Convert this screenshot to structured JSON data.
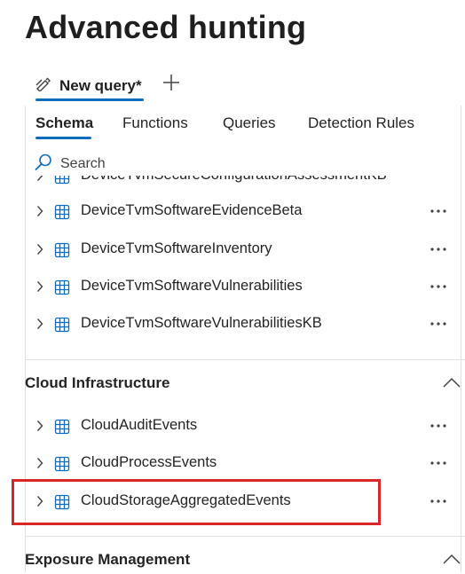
{
  "page": {
    "title": "Advanced hunting"
  },
  "query_tab": {
    "label": "New query*",
    "icon": "edit-pencil-icon",
    "add_icon": "plus-icon"
  },
  "subtabs": [
    {
      "label": "Schema",
      "active": true
    },
    {
      "label": "Functions",
      "active": false
    },
    {
      "label": "Queries",
      "active": false
    },
    {
      "label": "Detection Rules",
      "active": false
    }
  ],
  "search": {
    "label": "Search",
    "icon": "search-icon"
  },
  "device_tables": [
    {
      "name": "DeviceTvmSecureConfigurationAssessmentKB",
      "partial": true
    },
    {
      "name": "DeviceTvmSoftwareEvidenceBeta"
    },
    {
      "name": "DeviceTvmSoftwareInventory"
    },
    {
      "name": "DeviceTvmSoftwareVulnerabilities"
    },
    {
      "name": "DeviceTvmSoftwareVulnerabilitiesKB"
    }
  ],
  "sections": [
    {
      "title": "Cloud Infrastructure",
      "expanded": true
    },
    {
      "title": "Exposure Management",
      "expanded": true
    }
  ],
  "cloud_tables": [
    {
      "name": "CloudAuditEvents"
    },
    {
      "name": "CloudProcessEvents"
    },
    {
      "name": "CloudStorageAggregatedEvents",
      "highlighted": true
    }
  ],
  "colors": {
    "accent": "#0f6cbd",
    "highlight": "#d92626",
    "table_icon": "#0f6cbd"
  }
}
